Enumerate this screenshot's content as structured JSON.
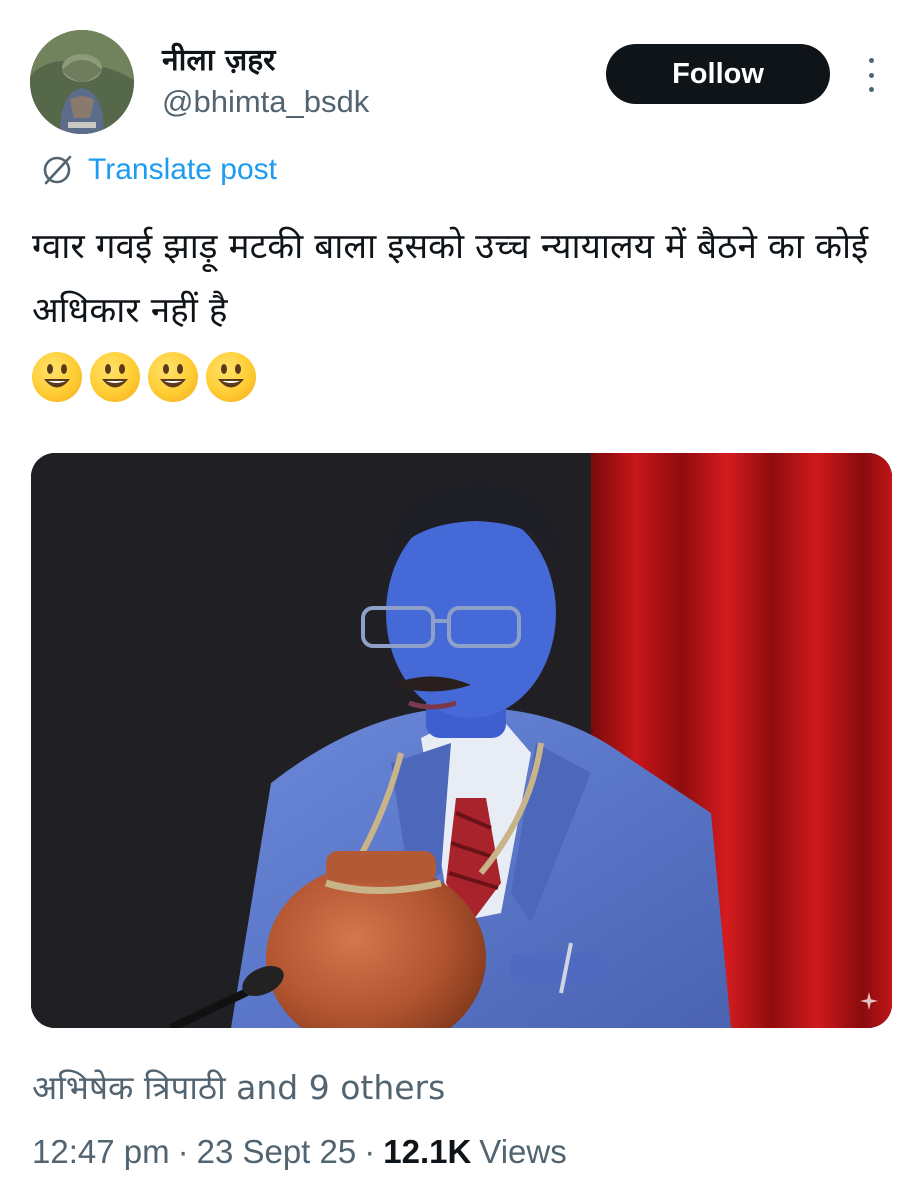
{
  "author": {
    "display_name": "नीला ज़हर",
    "handle": "@bhimta_bsdk"
  },
  "actions": {
    "follow_label": "Follow",
    "more_icon": "more-vertical-icon"
  },
  "translate": {
    "icon": "globe-slash-icon",
    "label": "Translate post"
  },
  "post": {
    "text": "ग्वार गवई झाड़ू मटकी बाला इसको उच्च न्यायालय में बैठने का कोई अधिकार नहीं है",
    "emojis": [
      "smiley-emoji",
      "smiley-emoji",
      "smiley-emoji",
      "smiley-emoji"
    ]
  },
  "media": {
    "sparkle_icon": "sparkle-icon"
  },
  "social_context": {
    "text": "अभिषेक त्रिपाठी and 9 others"
  },
  "meta": {
    "time": "12:47 pm",
    "separator": "·",
    "date": "23 Sept 25",
    "views_count": "12.1K",
    "views_label": "Views"
  },
  "colors": {
    "accent": "#1d9bf0",
    "text_primary": "#0f1419",
    "text_secondary": "#536471",
    "button_bg": "#0f1419"
  }
}
